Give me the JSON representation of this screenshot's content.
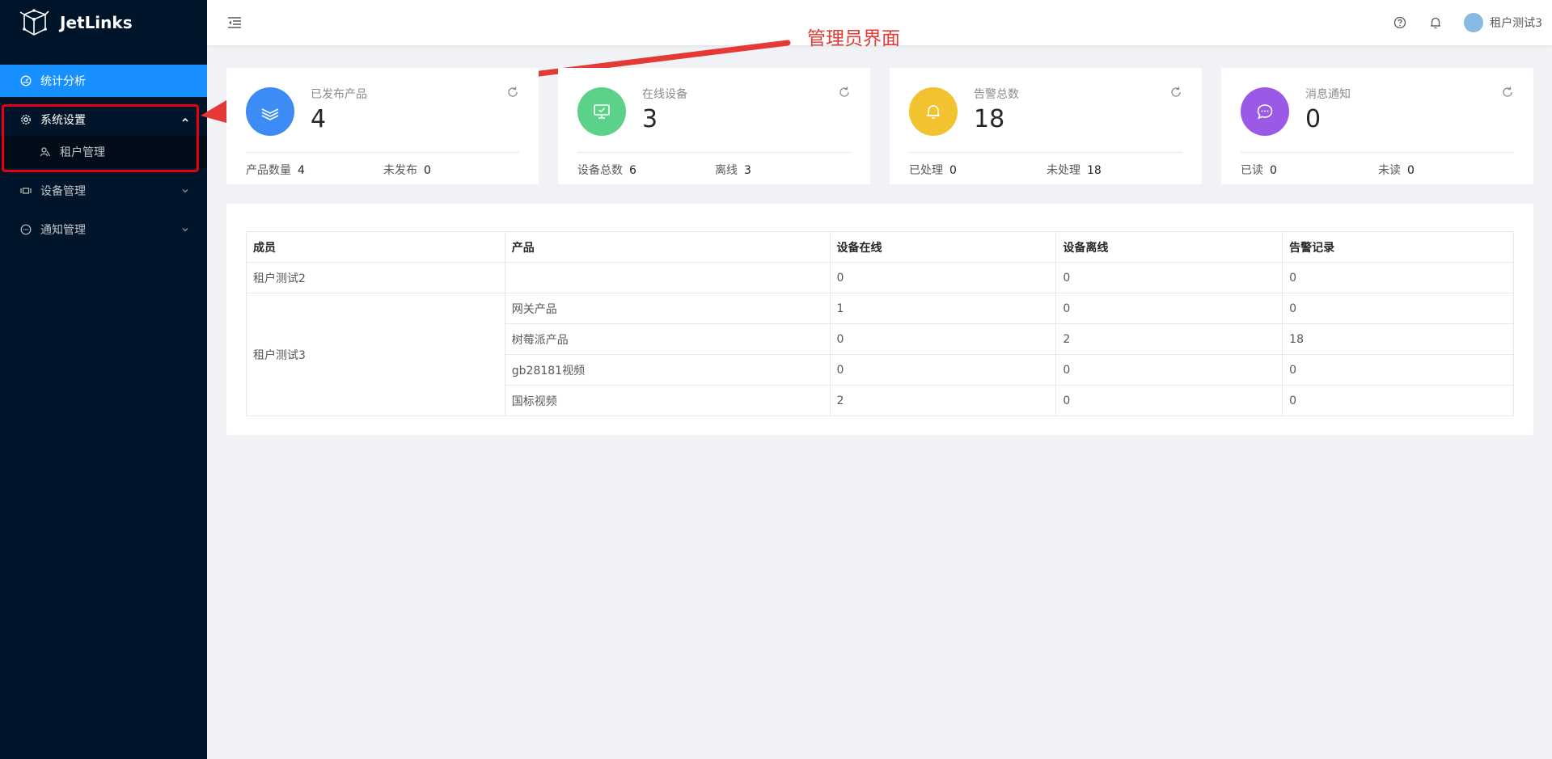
{
  "app": {
    "name": "JetLinks"
  },
  "sidebar": {
    "items": [
      {
        "label": "统计分析",
        "icon": "dashboard-icon",
        "active": true
      },
      {
        "label": "系统设置",
        "icon": "gear-icon",
        "open": true,
        "children": [
          {
            "label": "租户管理",
            "icon": "users-icon"
          }
        ]
      },
      {
        "label": "设备管理",
        "icon": "device-icon"
      },
      {
        "label": "通知管理",
        "icon": "message-icon"
      }
    ]
  },
  "header": {
    "username": "租户测试3"
  },
  "annotation": {
    "text": "管理员界面",
    "color": "#e53935"
  },
  "cards": [
    {
      "title": "已发布产品",
      "value": "4",
      "color": "#3d8bf5",
      "icon": "layers-icon",
      "foot": [
        {
          "label": "产品数量",
          "value": "4"
        },
        {
          "label": "未发布",
          "value": "0"
        }
      ]
    },
    {
      "title": "在线设备",
      "value": "3",
      "color": "#5cd18a",
      "icon": "monitor-icon",
      "foot": [
        {
          "label": "设备总数",
          "value": "6"
        },
        {
          "label": "离线",
          "value": "3"
        }
      ]
    },
    {
      "title": "告警总数",
      "value": "18",
      "color": "#f2c230",
      "icon": "bell-icon",
      "foot": [
        {
          "label": "已处理",
          "value": "0"
        },
        {
          "label": "未处理",
          "value": "18"
        }
      ]
    },
    {
      "title": "消息通知",
      "value": "0",
      "color": "#9b59e6",
      "icon": "chat-icon",
      "foot": [
        {
          "label": "已读",
          "value": "0"
        },
        {
          "label": "未读",
          "value": "0"
        }
      ]
    }
  ],
  "table": {
    "headers": [
      "成员",
      "产品",
      "设备在线",
      "设备离线",
      "告警记录"
    ],
    "rows": [
      {
        "member": "租户测试2",
        "product": "",
        "online": "0",
        "offline": "0",
        "alarms": "0"
      },
      {
        "member": "租户测试3",
        "product": "网关产品",
        "online": "1",
        "offline": "0",
        "alarms": "0"
      },
      {
        "member": "",
        "product": "树莓派产品",
        "online": "0",
        "offline": "2",
        "alarms": "18"
      },
      {
        "member": "",
        "product": "gb28181视频",
        "online": "0",
        "offline": "0",
        "alarms": "0"
      },
      {
        "member": "",
        "product": "国标视频",
        "online": "2",
        "offline": "0",
        "alarms": "0"
      }
    ]
  }
}
